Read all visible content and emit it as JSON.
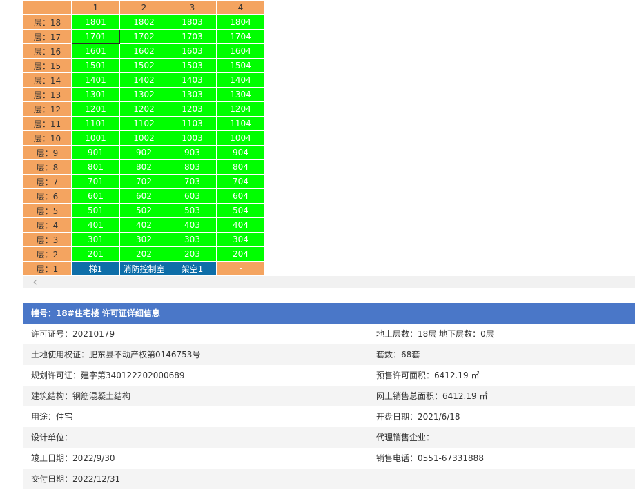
{
  "grid": {
    "columns": [
      "1",
      "2",
      "3",
      "4"
    ],
    "rows": [
      {
        "floor": "层：18",
        "units": [
          "1801",
          "1802",
          "1803",
          "1804"
        ]
      },
      {
        "floor": "层：17",
        "units": [
          "1701",
          "1702",
          "1703",
          "1704"
        ]
      },
      {
        "floor": "层：16",
        "units": [
          "1601",
          "1602",
          "1603",
          "1604"
        ]
      },
      {
        "floor": "层：15",
        "units": [
          "1501",
          "1502",
          "1503",
          "1504"
        ]
      },
      {
        "floor": "层：14",
        "units": [
          "1401",
          "1402",
          "1403",
          "1404"
        ]
      },
      {
        "floor": "层：13",
        "units": [
          "1301",
          "1302",
          "1303",
          "1304"
        ]
      },
      {
        "floor": "层：12",
        "units": [
          "1201",
          "1202",
          "1203",
          "1204"
        ]
      },
      {
        "floor": "层：11",
        "units": [
          "1101",
          "1102",
          "1103",
          "1104"
        ]
      },
      {
        "floor": "层：10",
        "units": [
          "1001",
          "1002",
          "1003",
          "1004"
        ]
      },
      {
        "floor": "层：9",
        "units": [
          "901",
          "902",
          "903",
          "904"
        ]
      },
      {
        "floor": "层：8",
        "units": [
          "801",
          "802",
          "803",
          "804"
        ]
      },
      {
        "floor": "层：7",
        "units": [
          "701",
          "702",
          "703",
          "704"
        ]
      },
      {
        "floor": "层：6",
        "units": [
          "601",
          "602",
          "603",
          "604"
        ]
      },
      {
        "floor": "层：5",
        "units": [
          "501",
          "502",
          "503",
          "504"
        ]
      },
      {
        "floor": "层：4",
        "units": [
          "401",
          "402",
          "403",
          "404"
        ]
      },
      {
        "floor": "层：3",
        "units": [
          "301",
          "302",
          "303",
          "304"
        ]
      },
      {
        "floor": "层：2",
        "units": [
          "201",
          "202",
          "203",
          "204"
        ]
      },
      {
        "floor": "层：1",
        "units": [
          "梯1",
          "消防控制室",
          "架空1",
          "-"
        ]
      }
    ],
    "colors": {
      "header": "#f4a460",
      "available": "#00ff00",
      "special": "#0e6ea8",
      "empty": "#f4a460"
    }
  },
  "scroll": {
    "left_icon": "chevron-left-icon",
    "left_glyph": "‹"
  },
  "detail": {
    "title": "幢号：18#住宅楼 许可证详细信息",
    "left": [
      "许可证号：20210179",
      "土地使用权证：肥东县不动产权第0146753号",
      "规划许可证：建字第340122202000689",
      "建筑结构：钢筋混凝土结构",
      "用途：住宅",
      "设计单位：",
      "竣工日期：2022/9/30",
      "交付日期：2022/12/31"
    ],
    "right": [
      "地上层数：18层  地下层数：0层",
      "套数：68套",
      "预售许可面积：6412.19 ㎡",
      "网上销售总面积：6412.19 ㎡",
      "开盘日期：2021/6/18",
      "代理销售企业：",
      "销售电话：0551-67331888",
      ""
    ]
  }
}
